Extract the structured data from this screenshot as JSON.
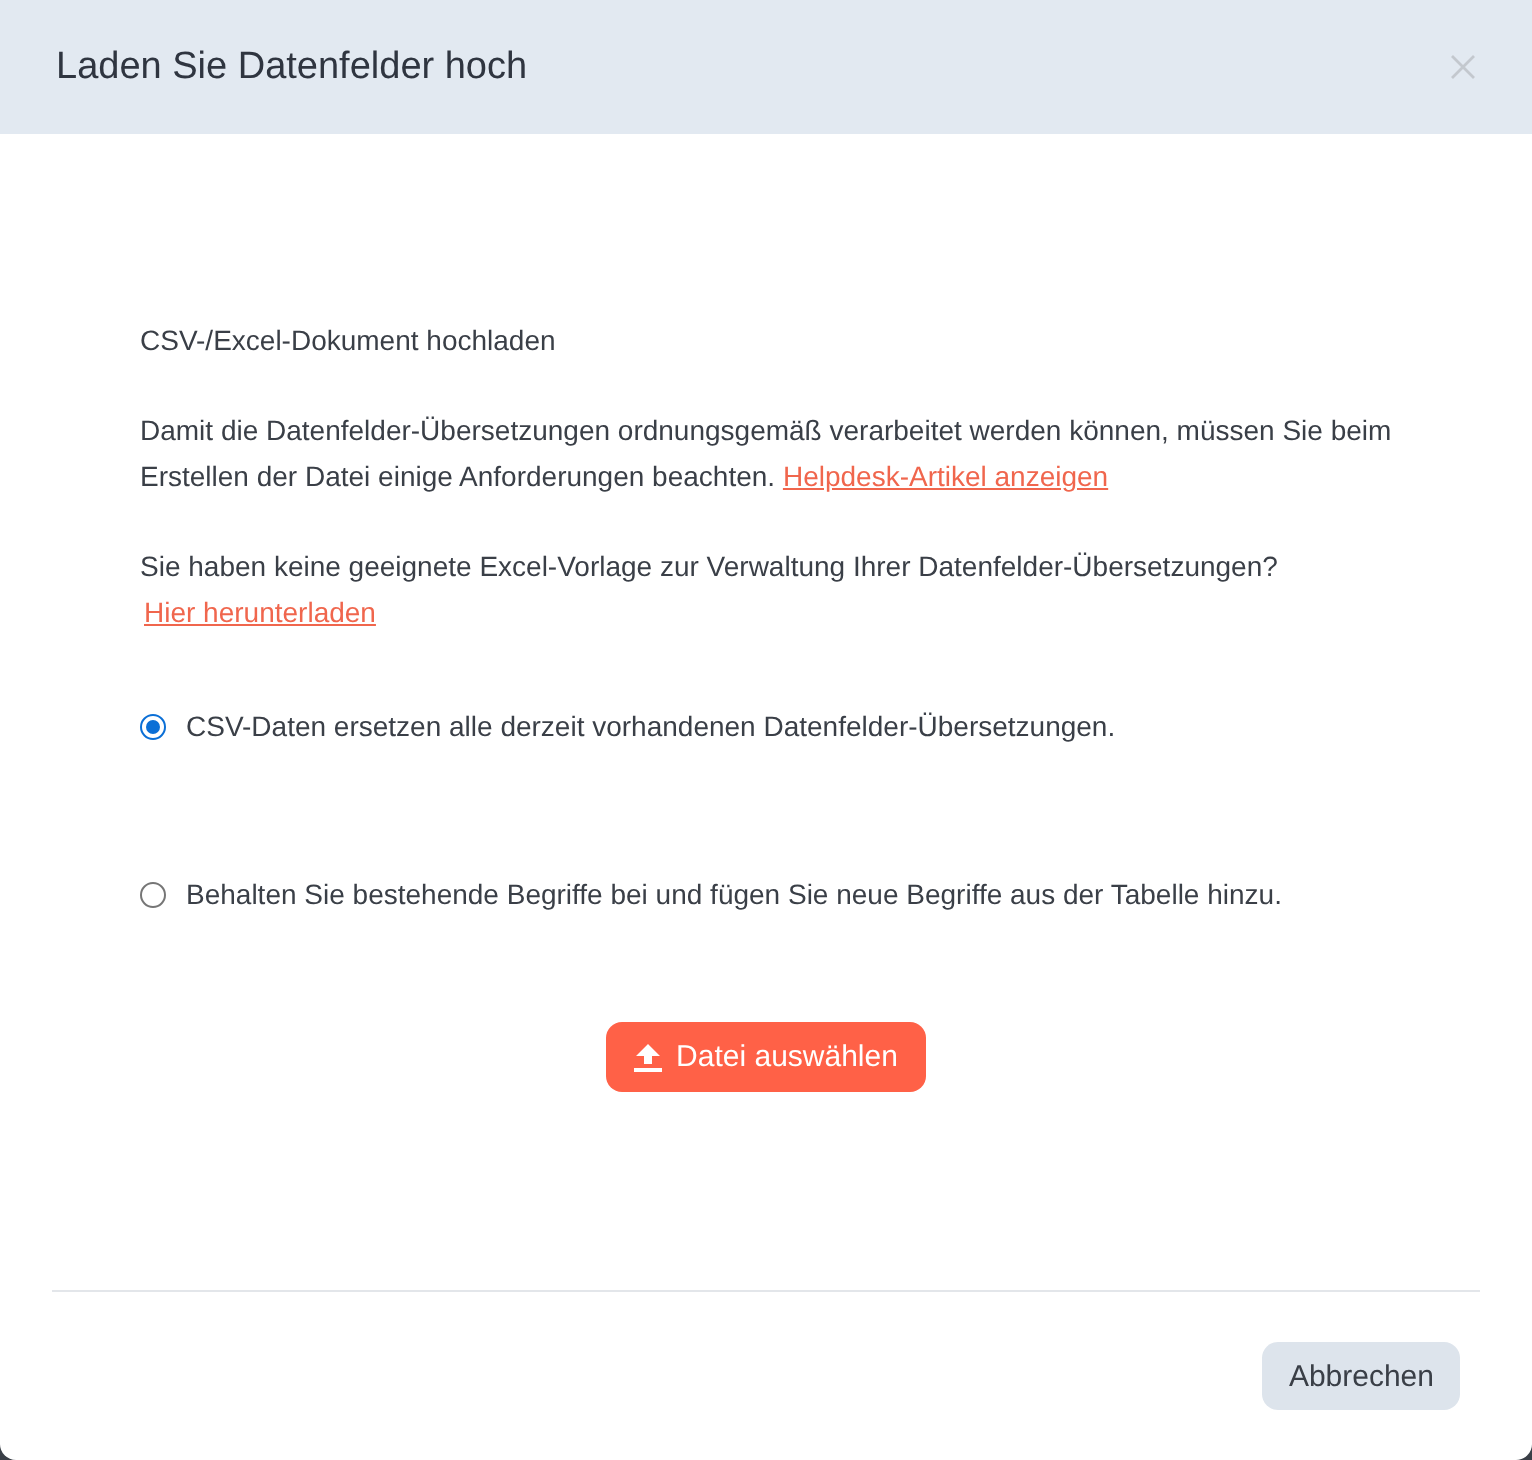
{
  "dialog": {
    "title": "Laden Sie Datenfelder hoch"
  },
  "body": {
    "heading": "CSV-/Excel-Dokument hochladen",
    "paragraphs": [
      {
        "text": "Damit die Datenfelder-Übersetzungen ordnungsgemäß verarbeitet werden können, müssen Sie beim Erstellen der Datei einige Anforderungen beachten.",
        "link": "Helpdesk-Artikel anzeigen",
        "link_on_new_line": false
      },
      {
        "text": "Sie haben keine geeignete Excel-Vorlage zur Verwaltung Ihrer Datenfelder-Übersetzungen?",
        "link": "Hier herunterladen",
        "link_on_new_line": true
      }
    ],
    "options": [
      {
        "label": "CSV-Daten ersetzen alle derzeit vorhandenen Datenfelder-Übersetzungen.",
        "selected": true
      },
      {
        "label": "Behalten Sie bestehende Begriffe bei und fügen Sie neue Begriffe aus der Tabelle hinzu.",
        "selected": false
      }
    ],
    "upload_button": "Datei auswählen"
  },
  "footer": {
    "buttons": [
      "Abbrechen"
    ]
  }
}
